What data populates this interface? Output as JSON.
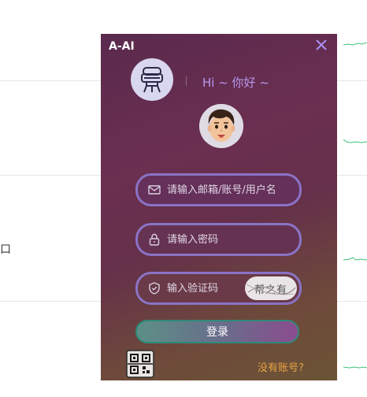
{
  "background": {
    "side_text": "口"
  },
  "login": {
    "title": "A-AI",
    "greeting": "Hi ~ 你好 ~",
    "email_placeholder": "请输入邮箱/账号/用户名",
    "password_placeholder": "请输入密码",
    "captcha_placeholder": "输入验证码",
    "captcha_text": "帮之有",
    "login_label": "登录",
    "signup_label": "没有账号?"
  },
  "colors": {
    "accent_border": "#8a73c6",
    "greeting": "#b89af0",
    "signup_link": "#e8a244",
    "login_button_border": "#2f8a7a"
  },
  "icons": [
    "close-icon",
    "robot-logo-icon",
    "user-avatar-icon",
    "mail-icon",
    "lock-icon",
    "shield-icon",
    "qr-code-icon"
  ]
}
